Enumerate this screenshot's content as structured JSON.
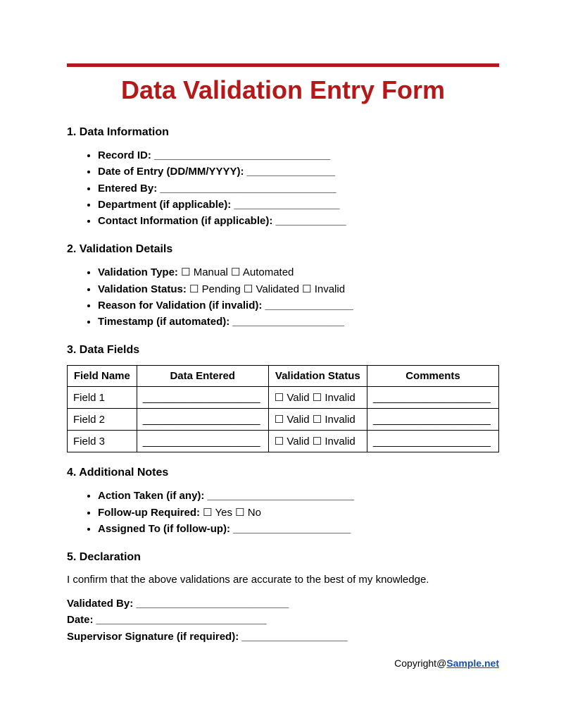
{
  "title": "Data Validation Entry Form",
  "s1": {
    "head": "1. Data Information",
    "record_id": "Record ID: ______________________________",
    "date_entry": "Date of Entry (DD/MM/YYYY): _______________",
    "entered_by": "Entered By: ______________________________",
    "department": "Department (if applicable): __________________",
    "contact": "Contact Information (if applicable): ____________"
  },
  "s2": {
    "head": "2. Validation Details",
    "val_type_label": "Validation Type: ",
    "val_type_opts": "☐ Manual ☐ Automated",
    "val_status_label": "Validation Status: ",
    "val_status_opts": "☐ Pending ☐ Validated ☐ Invalid",
    "reason": "Reason for Validation (if invalid): _______________",
    "timestamp": "Timestamp (if automated): ___________________"
  },
  "s3": {
    "head": "3. Data Fields",
    "th1": "Field Name",
    "th2": "Data Entered",
    "th3": "Validation Status",
    "th4": "Comments",
    "rows": [
      {
        "name": "Field 1",
        "entered": "____________________",
        "status": "☐ Valid ☐ Invalid",
        "comments": "____________________"
      },
      {
        "name": "Field 2",
        "entered": "____________________",
        "status": "☐ Valid ☐ Invalid",
        "comments": "____________________"
      },
      {
        "name": "Field 3",
        "entered": "____________________",
        "status": "☐ Valid ☐ Invalid",
        "comments": "____________________"
      }
    ]
  },
  "s4": {
    "head": "4. Additional Notes",
    "action": "Action Taken (if any): _________________________",
    "followup_label": "Follow-up Required: ",
    "followup_opts": "☐ Yes ☐ No",
    "assigned": "Assigned To (if follow-up): ____________________"
  },
  "s5": {
    "head": "5. Declaration",
    "para": "I confirm that the above validations are accurate to the best of my knowledge.",
    "validated_by": "Validated By: __________________________",
    "date": "Date: _____________________________",
    "supervisor": "Supervisor Signature (if required): __________________"
  },
  "copyright_prefix": "Copyright@",
  "copyright_link": "Sample.net"
}
